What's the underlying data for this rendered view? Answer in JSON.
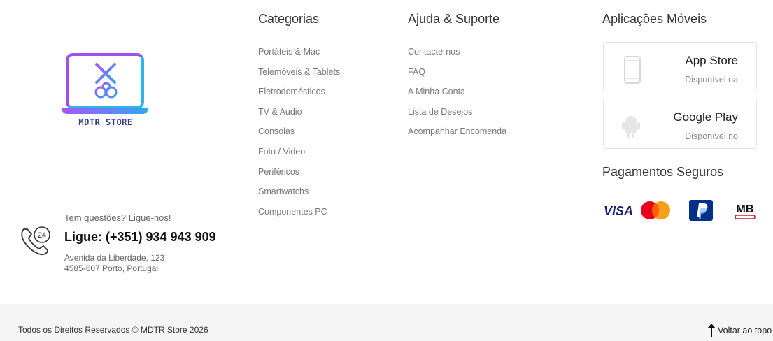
{
  "brand": {
    "logo_text": "MDTR STORE"
  },
  "contact": {
    "question": "Tem questões? Ligue-nos!",
    "phone": "Ligue: (+351) 934 943 909",
    "address_line1": "Avenida da Liberdade, 123",
    "address_line2": "4585-607 Porto, Portugal",
    "icon": "phone-24h-icon"
  },
  "categories": {
    "title": "Categorias",
    "items": [
      "Portáteis & Mac",
      "Telemóveis & Tablets",
      "Eletrodomésticos",
      "TV & Audio",
      "Consolas",
      "Foto / Video",
      "Periféricos",
      "Smartwatchs",
      "Componentes PC"
    ]
  },
  "support": {
    "title": "Ajuda & Suporte",
    "items": [
      "Contacte-nos",
      "FAQ",
      "A Minha Conta",
      "Lista de Desejos",
      "Acompanhar Encomenda"
    ]
  },
  "apps": {
    "title": "Aplicações Móveis",
    "app_store": {
      "name": "App Store",
      "sub": "Disponível na",
      "icon": "phone-icon"
    },
    "google_play": {
      "name": "Google Play",
      "sub": "Disponível no",
      "icon": "android-icon"
    }
  },
  "payments": {
    "title": "Pagamentos Seguros",
    "methods": [
      "visa-icon",
      "mastercard-icon",
      "paypal-icon",
      "multibanco-icon"
    ],
    "visa_text": "VISA",
    "mb_text": "MB",
    "colors": {
      "visa": "#1a1f71",
      "mc_red": "#eb001b",
      "mc_yellow": "#f79e1b",
      "paypal": "#003087"
    }
  },
  "footer": {
    "copyright": "Todos os Direitos Reservados © MDTR Store 2026",
    "back_to_top": "Voltar ao topo"
  }
}
